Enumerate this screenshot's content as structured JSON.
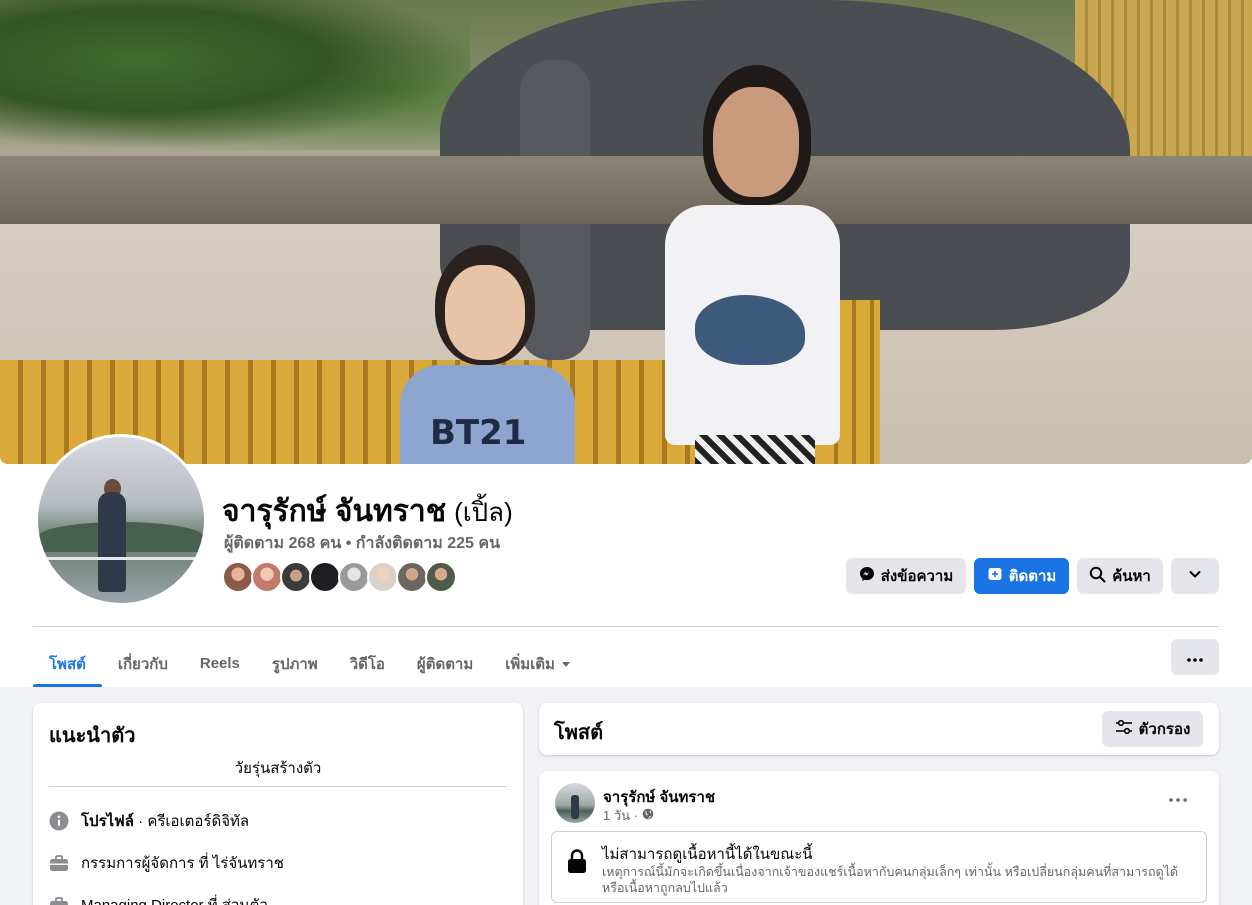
{
  "profile": {
    "name": "จารุรักษ์ จันทราช",
    "alt_name": "(เปิ้ล)",
    "follow_stats": "ผู้ติดตาม 268 คน • กำลังติดตาม 225 คน"
  },
  "header_actions": {
    "message_label": "ส่งข้อความ",
    "follow_label": "ติดตาม",
    "search_label": "ค้นหา"
  },
  "tabs": [
    {
      "label": "โพสต์",
      "active": true
    },
    {
      "label": "เกี่ยวกับ"
    },
    {
      "label": "Reels"
    },
    {
      "label": "รูปภาพ"
    },
    {
      "label": "วิดีโอ"
    },
    {
      "label": "ผู้ติดตาม"
    },
    {
      "label": "เพิ่มเติม"
    }
  ],
  "intro": {
    "title": "แนะนำตัว",
    "bio": "วัยรุ่นสร้างตัว",
    "items": [
      {
        "bold": "โปรไฟล์",
        "rest": " · ครีเอเตอร์ดิจิทัล",
        "icon": "info-icon"
      },
      {
        "bold": "",
        "rest": "กรรมการผู้จัดการ ที่ ไร่จันทราช",
        "icon": "briefcase-icon"
      },
      {
        "bold": "",
        "rest": "Managing Director ที่ ส่วนตัว",
        "icon": "briefcase-icon"
      }
    ]
  },
  "posts": {
    "title": "โพสต์",
    "filter_label": "ตัวกรอง",
    "post": {
      "author": "จารุรักษ์ จันทราช",
      "time": "1 วัน ·",
      "locked_title": "ไม่สามารถดูเนื้อหานี้ได้ในขณะนี้",
      "locked_desc": "เหตุการณ์นี้มักจะเกิดขึ้นเนื่องจากเจ้าของแชร์เนื้อหากับคนกลุ่มเล็กๆ เท่านั้น หรือเปลี่ยนกลุ่มคนที่สามารถดูได้ หรือเนื้อหาถูกลบไปแล้ว"
    }
  },
  "colors": {
    "accent": "#1b74e4",
    "page_bg": "#f0f2f5",
    "secondary_text": "#65676b",
    "button_grey": "#e4e6eb"
  }
}
